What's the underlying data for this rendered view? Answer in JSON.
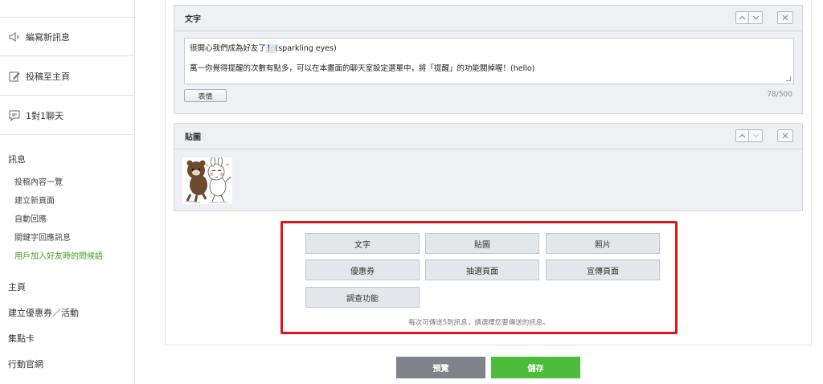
{
  "sidebar": {
    "items": [
      {
        "label": "編寫新訊息",
        "icon": "speaker-icon"
      },
      {
        "label": "投稿至主頁",
        "icon": "edit-icon"
      },
      {
        "label": "1對1聊天",
        "icon": "chat-icon"
      }
    ],
    "section_title": "訊息",
    "sub_items": [
      {
        "label": "投稿內容一覽"
      },
      {
        "label": "建立新頁面"
      },
      {
        "label": "自動回應"
      },
      {
        "label": "關鍵字回應訊息"
      },
      {
        "label": "用戶加入好友時的問候語"
      }
    ],
    "main_items": [
      {
        "label": "主頁"
      },
      {
        "label": "建立優惠券／活動"
      },
      {
        "label": "集點卡"
      },
      {
        "label": "行動官網"
      }
    ]
  },
  "text_panel": {
    "title": "文字",
    "line1_before": "很開心我們成為好友了",
    "line1_highlight": "！",
    "line1_after": "(sparkling eyes)",
    "line2": "萬一你覺得提醒的次數有點多，可以在本畫面的聊天室設定選單中，將「提醒」的功能關掉喔！(hello)",
    "emoji_button": "表情",
    "counter": "78/500"
  },
  "sticker_panel": {
    "title": "貼圖"
  },
  "options": {
    "buttons": [
      "文字",
      "貼圖",
      "照片",
      "優惠券",
      "抽選頁面",
      "宣傳頁面",
      "調查功能"
    ],
    "hint": "每次可傳送5則訊息，請選擇您要傳送的訊息。"
  },
  "footer": {
    "preview_label": "預覽",
    "save_label": "儲存"
  },
  "colors": {
    "accent_green": "#4bbd3b",
    "active_link": "#3d9d1f",
    "highlight_border": "#e3121b",
    "preview_gray": "#7f8389"
  }
}
